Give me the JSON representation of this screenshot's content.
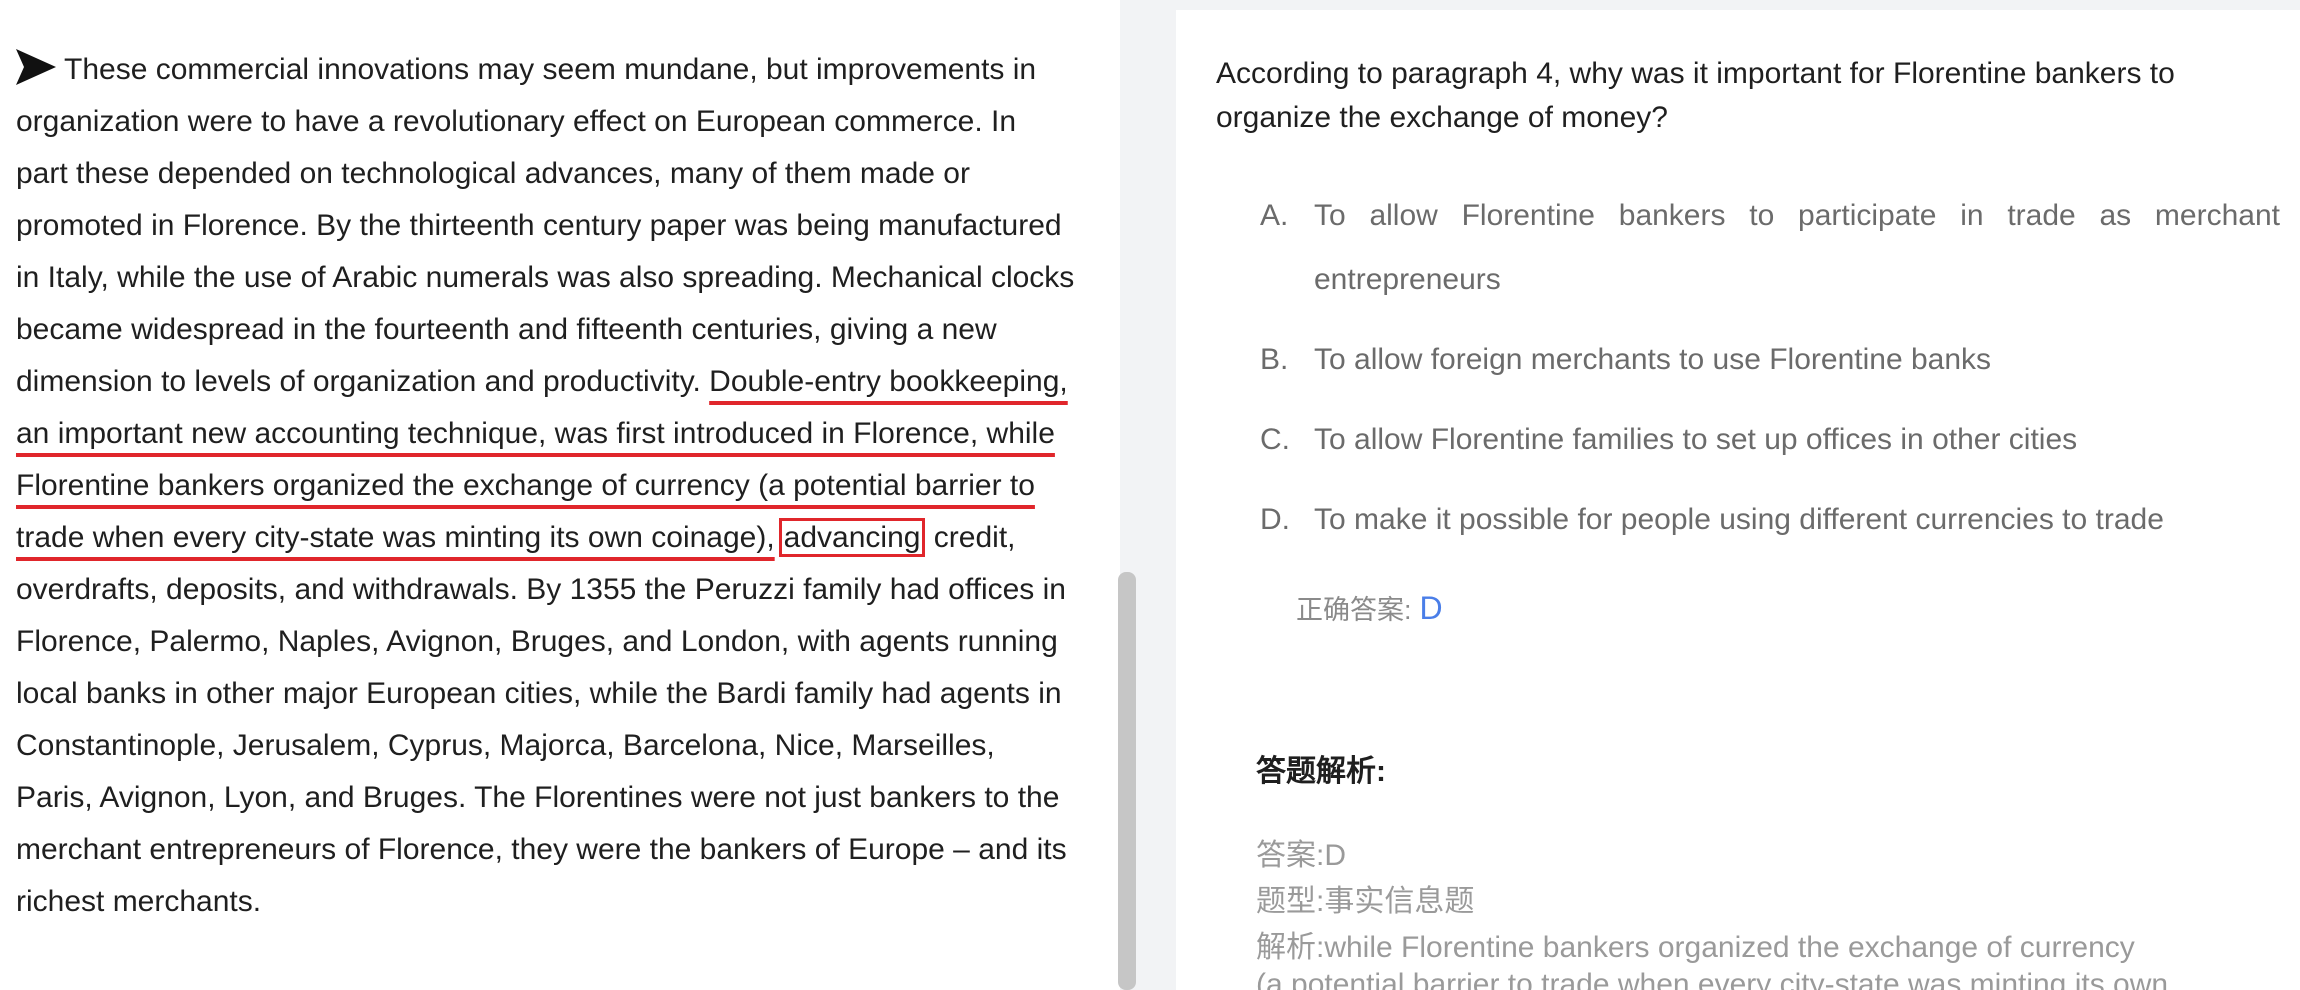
{
  "passage": {
    "arrow_icon": "arrow-right-icon",
    "part1": "These commercial innovations may seem mundane, but improvements in organization were to have a revolutionary effect on European commerce. In part these depended on technological advances, many of them made or promoted in Florence. By the thirteenth century paper was being manufactured in Italy, while the use of Arabic numerals was also spreading. Mechanical clocks became widespread in the fourteenth and fifteenth centuries, giving a new dimension to levels of organization and productivity. ",
    "underlined": "Double-entry bookkeeping, an important new accounting technique, was first introduced in Florence, while Florentine bankers organized the exchange of currency (a potential barrier to trade when every city-state was minting its own coinage),",
    "boxed": "advancing",
    "part2": " credit, overdrafts, deposits, and withdrawals. By 1355 the Peruzzi family had offices in Florence, Palermo, Naples, Avignon, Bruges, and London, with agents running local banks in other major European cities, while the Bardi family had agents in Constantinople, Jerusalem, Cyprus, Majorca, Barcelona, Nice, Marseilles, Paris, Avignon, Lyon, and Bruges. The Florentines were not just bankers to the merchant entrepreneurs of Florence, they were the bankers of Europe – and its richest merchants."
  },
  "question": "According to paragraph 4, why was it important for Florentine bankers to organize the exchange of money?",
  "options": [
    {
      "letter": "A.",
      "text": "To allow Florentine bankers to participate in trade as merchant entrepreneurs"
    },
    {
      "letter": "B.",
      "text": "To allow foreign merchants to use Florentine banks"
    },
    {
      "letter": "C.",
      "text": "To allow Florentine families to set up offices in other cities"
    },
    {
      "letter": "D.",
      "text": "To make it possible for people using different currencies to trade"
    }
  ],
  "correct_answer": {
    "label": "正确答案:",
    "value": "D"
  },
  "analysis": {
    "title": "答题解析:",
    "answer_line": "答案:D",
    "type_line": "题型:事实信息题",
    "explanation_line1": "解析:while Florentine bankers organized the exchange of currency",
    "explanation_line2": "(a potential barrier to trade when every city-state was minting its own"
  },
  "colors": {
    "highlight_red": "#e0262b",
    "answer_blue": "#4a7ee8"
  }
}
